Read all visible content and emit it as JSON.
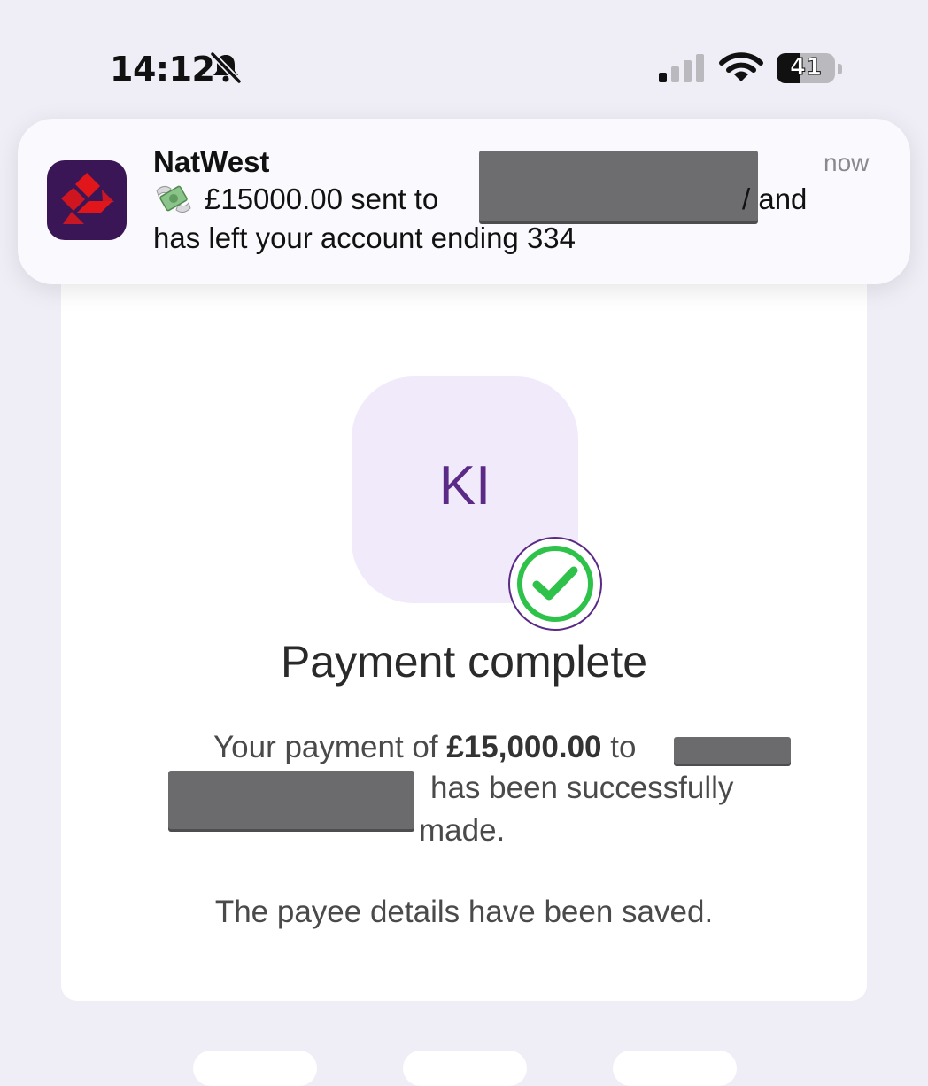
{
  "status_bar": {
    "time": "14:12",
    "battery_level": "41",
    "battery_fraction": 0.41,
    "icons": [
      "bell-slash-icon",
      "cellular-signal-icon",
      "wifi-icon",
      "battery-icon"
    ]
  },
  "notification": {
    "app_name": "NatWest",
    "time": "now",
    "line1_prefix": "£15000.00 sent to",
    "line1_suffix": "/ and",
    "line2": "has left your account ending 334",
    "icons": [
      "natwest-logo-icon",
      "money-with-wings-icon"
    ]
  },
  "payment": {
    "avatar_initials": "KI",
    "title": "Payment complete",
    "message_prefix": "Your payment of",
    "amount": "£15,000.00",
    "message_to": "to",
    "message_line2": "has been successfully",
    "message_line3": "made.",
    "saved_note": "The payee details have been saved.",
    "icons": [
      "check-circle-icon"
    ]
  },
  "colors": {
    "background": "#efeef6",
    "avatar_bg": "#f1eafa",
    "avatar_text": "#5a2a86",
    "success_green": "#2fc24a",
    "brand_purple": "#3b1657",
    "brand_red": "#e0161b"
  }
}
